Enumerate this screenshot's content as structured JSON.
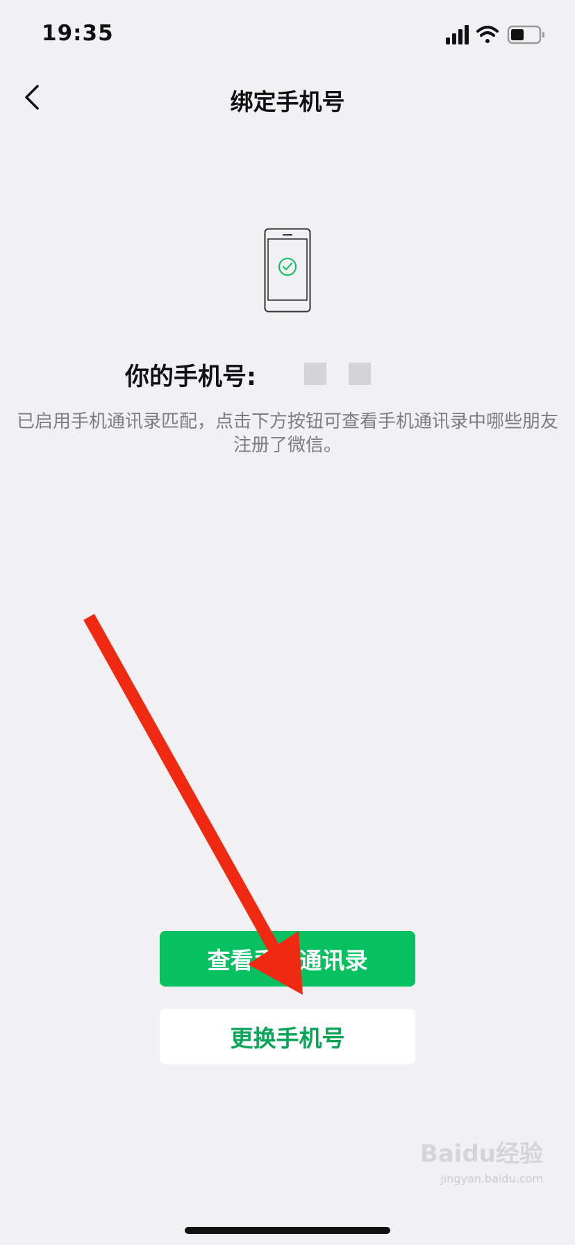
{
  "status_bar": {
    "time": "19:35",
    "icons": [
      "signal-icon",
      "wifi-icon",
      "battery-icon"
    ]
  },
  "nav": {
    "back_icon": "chevron-left-icon",
    "title": "绑定手机号"
  },
  "main": {
    "illustration": "phone-check-icon",
    "phone_label": "你的手机号:",
    "description": "已启用手机通讯录匹配，点击下方按钮可查看手机通讯录中哪些朋友注册了微信。"
  },
  "buttons": {
    "view_contacts": "查看手机通讯录",
    "change_phone": "更换手机号"
  },
  "annotation": {
    "arrow_color": "#f02a12"
  },
  "watermark": {
    "brand": "Baidu经验",
    "url": "jingyan.baidu.com"
  },
  "colors": {
    "accent": "#07c160",
    "background": "#f1f1f3"
  }
}
